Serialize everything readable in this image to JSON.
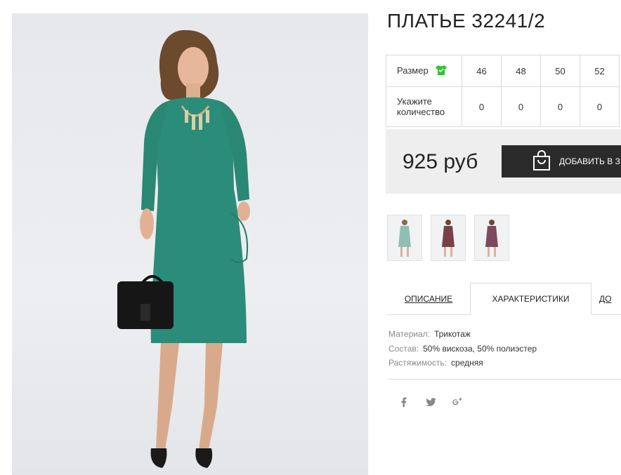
{
  "product": {
    "title": "ПЛАТЬЕ 32241/2",
    "size_label": "Размер",
    "quantity_label_line1": "Укажите",
    "quantity_label_line2": "количество",
    "sizes": [
      "46",
      "48",
      "50",
      "52"
    ],
    "quantities": [
      "0",
      "0",
      "0",
      "0"
    ],
    "size_icon": "tshirt-check-icon",
    "size_icon_color": "#2ec42e"
  },
  "purchase": {
    "price": "925 руб",
    "add_to_cart_label": "ДОБАВИТЬ В З",
    "cart_icon": "shopping-bag-icon"
  },
  "gallery": {
    "thumbnails": [
      "mint-dress-thumbnail",
      "burgundy-dress-thumbnail",
      "plum-dress-thumbnail"
    ],
    "thumbnail_colors": [
      "#8fbfb1",
      "#7a4048",
      "#7c4a5e"
    ],
    "main_dress_color": "#2b8c79"
  },
  "tabs": {
    "description": "ОПИСАНИЕ",
    "characteristics": "ХАРАКТЕРИСТИКИ",
    "delivery": "ДО"
  },
  "specs": [
    {
      "label": "Материал:",
      "value": "Трикотаж"
    },
    {
      "label": "Состав:",
      "value": "50% вискоза, 50% полиэстер"
    },
    {
      "label": "Растяжимость:",
      "value": "средняя"
    }
  ],
  "social": [
    "facebook-icon",
    "twitter-icon",
    "google-plus-icon"
  ]
}
